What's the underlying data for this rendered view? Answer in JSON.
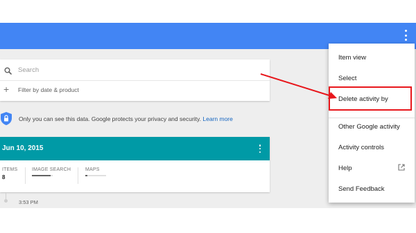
{
  "search": {
    "placeholder": "Search"
  },
  "filter": {
    "label": "Filter by date & product"
  },
  "privacy": {
    "text": "Only you can see this data. Google protects your privacy and security.",
    "link": "Learn more"
  },
  "day_card": {
    "date": "Jun 10, 2015",
    "stats": [
      {
        "label": "ITEMS",
        "value": "8",
        "fill": null
      },
      {
        "label": "IMAGE SEARCH",
        "value": "",
        "fill": 0.9
      },
      {
        "label": "MAPS",
        "value": "",
        "fill": 0.1
      }
    ]
  },
  "timeline": {
    "time": "3:53 PM"
  },
  "menu": {
    "items": [
      "Item view",
      "Select",
      "Delete activity by",
      "Other Google activity",
      "Activity controls",
      "Help",
      "Send Feedback"
    ]
  },
  "colors": {
    "topbar": "#4285f4",
    "date_header": "#009aa6",
    "annotation": "#e8161b",
    "link": "#1565c0"
  },
  "icons": {
    "topbar_menu": "more-vert-icon",
    "search": "search-icon",
    "filter": "plus-icon",
    "privacy": "shield-lock-icon",
    "card_menu": "more-vert-icon",
    "help": "open-in-new-icon"
  }
}
